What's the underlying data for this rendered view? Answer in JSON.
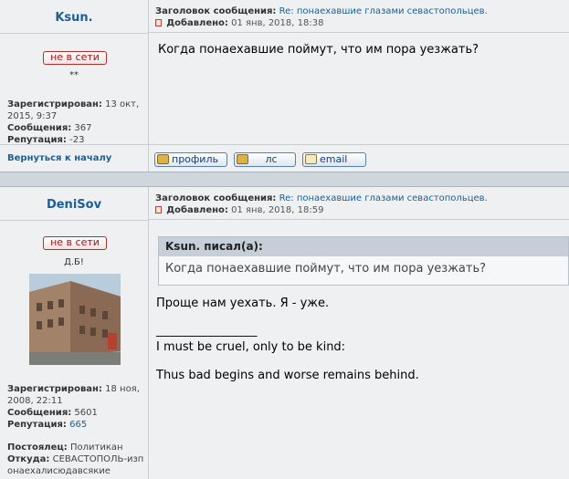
{
  "post1": {
    "author": "Ksun.",
    "subject_label": "Заголовок сообщения:",
    "subject": "Re: понаехавшие глазами севастопольцев.",
    "added_label": "Добавлено:",
    "added": "01 янв, 2018, 18:38",
    "status": "не в сети",
    "rank": "**",
    "reg_label": "Зарегистрирован:",
    "reg_value": "13 окт, 2015, 9:37",
    "msg_label": "Сообщения:",
    "msg_value": "367",
    "rep_label": "Репутация:",
    "rep_value": "-23",
    "body": "Когда понаехавшие поймут, что им пора уезжать?",
    "back_label": "Вернуться к началу",
    "btn_profile": "профиль",
    "btn_pm": "лс",
    "btn_email": "email"
  },
  "post2": {
    "author": "DeniSov",
    "subject_label": "Заголовок сообщения:",
    "subject": "Re: понаехавшие глазами севастопольцев.",
    "added_label": "Добавлено:",
    "added": "01 янв, 2018, 18:59",
    "status": "не в сети",
    "rank": "Д.Б!",
    "reg_label": "Зарегистрирован:",
    "reg_value": "18 ноя, 2008, 22:11",
    "msg_label": "Сообщения:",
    "msg_value": "5601",
    "rep_label": "Репутация:",
    "rep_value": "665",
    "regular_label": "Постоялец:",
    "regular_value": "Политикан",
    "from_label": "Откуда:",
    "from_value": "СЕВАСТОПОЛЬ-изпонаехалисюдавсякие",
    "quote_author": "Ksun. писал(а):",
    "quote_text": "Когда понаехавшие поймут, что им пора уезжать?",
    "body": "Проще нам уехать. Я - уже.",
    "sig_line": "_________________",
    "sig1": "I must be cruel, only to be kind:",
    "sig2": "Thus bad begins and worse remains behind."
  }
}
